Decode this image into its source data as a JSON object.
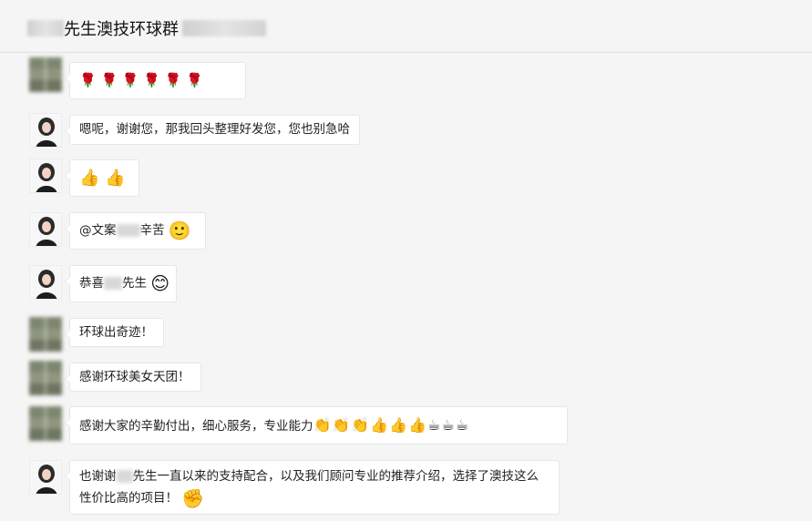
{
  "header": {
    "title": "先生澳技环球群"
  },
  "messages": [
    {
      "text": "🌹 🌹 🌹 🌹 🌹 🌹"
    },
    {
      "text": "嗯呢，谢谢您，那我回头整理好发您，您也别急哈"
    },
    {
      "text": "👍 👍"
    },
    {
      "prefix": "@文案",
      "suffix": "辛苦",
      "emoji": "🙂"
    },
    {
      "prefix": "恭喜",
      "suffix": "先生",
      "emoji": "😊"
    },
    {
      "text": "环球出奇迹！"
    },
    {
      "text": "感谢环球美女天团！"
    },
    {
      "text": "感谢大家的辛勤付出，细心服务，专业能力",
      "emoji": "👏👏👏👍👍👍☕☕☕"
    },
    {
      "prefix": "也谢谢",
      "suffix": "先生一直以来的支持配合，以及我们顾问专业的推荐介绍，选择了澳技这么性价比高的项目！",
      "emoji": "✊"
    }
  ]
}
